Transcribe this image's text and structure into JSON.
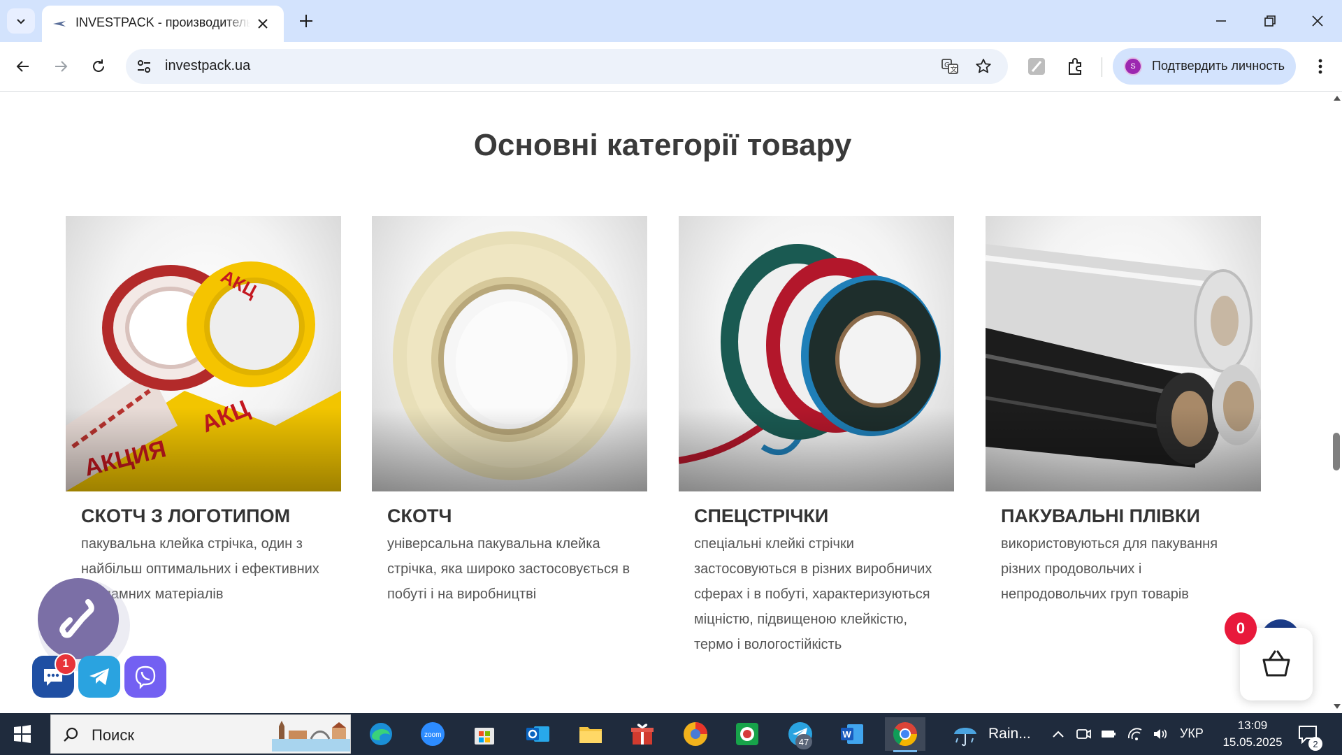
{
  "browser": {
    "tab_title": "INVESTPACK - производитель скотча",
    "url": "investpack.ua",
    "profile_label": "Подтвердить личность",
    "profile_initial": "S"
  },
  "page": {
    "section_title": "Основні категорії товару",
    "categories": [
      {
        "title": "СКОТЧ З ЛОГОТИПОМ",
        "description": "пакувальна клейка стрічка, один з найбільш оптимальних і ефективних рекламних матеріалів",
        "image_icon": "printed-tape-rolls"
      },
      {
        "title": "СКОТЧ",
        "description": "універсальна пакувальна клейка стрічка, яка широко застосовується в побуті і на виробництві",
        "image_icon": "clear-tape-roll"
      },
      {
        "title": "СПЕЦСТРІЧКИ",
        "description": "спеціальні клейкі стрічки застосовуються в різних виробничих сферах і в побуті, характеризуються міцністю, підвищеною клейкістю, термо і вологостійкість",
        "image_icon": "double-sided-tape-rolls"
      },
      {
        "title": "ПАКУВАЛЬНІ ПЛІВКИ",
        "description": "використовуються для пакування різних продовольчих і непродовольчих груп товарів",
        "image_icon": "stretch-film-rolls"
      }
    ],
    "chat_badge": "1",
    "cart_count": "0"
  },
  "taskbar": {
    "search_placeholder": "Поиск",
    "telegram_badge": "47",
    "weather": "Rain...",
    "language": "УКР",
    "time": "13:09",
    "date": "15.05.2025",
    "notifications": "2"
  },
  "colors": {
    "accent_purple": "#7b6fa6",
    "telegram": "#2aa3e0",
    "viber": "#7360f2",
    "cart_badge": "#e8193b",
    "taskbar": "#1f2b3d"
  }
}
